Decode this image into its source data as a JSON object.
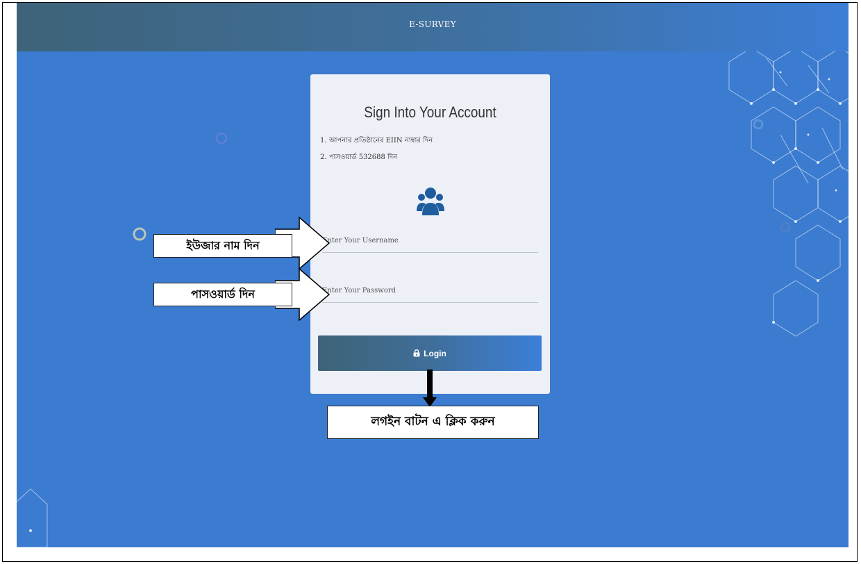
{
  "header": {
    "title": "E-SURVEY"
  },
  "card": {
    "title": "Sign Into Your Account",
    "steps": [
      "1. আপনার প্রতিষ্ঠানের EIIN নাম্বার দিন",
      "2. পাসওয়ার্ড 532688 দিন"
    ]
  },
  "form": {
    "username_placeholder": "Enter Your Username",
    "password_placeholder": "Enter Your Password",
    "login_label": "Login"
  },
  "annotations": {
    "username": "ইউজার নাম দিন",
    "password": "পাসওয়ার্ড দিন",
    "login": "লগইন বাটন এ ক্লিক করুন"
  },
  "icons": {
    "user_group": "users-icon",
    "lock": "lock-icon"
  },
  "colors": {
    "background": "#3b7bd0",
    "header_start": "#3e6379",
    "header_end": "#3c7ed6",
    "icon": "#1f5d9e"
  }
}
